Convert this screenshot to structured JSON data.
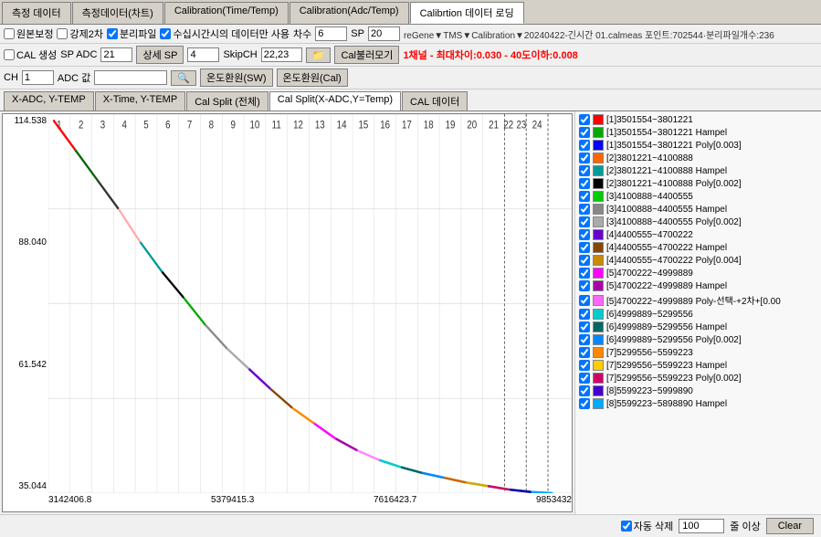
{
  "tabs": [
    {
      "label": "측정 데이터",
      "active": false
    },
    {
      "label": "측정데이터(차트)",
      "active": false
    },
    {
      "label": "Calibration(Time/Temp)",
      "active": false
    },
    {
      "label": "Calibration(Adc/Temp)",
      "active": false
    },
    {
      "label": "Calibrtion 데이터 로딩",
      "active": true
    }
  ],
  "toolbar1": {
    "checkbox_original": "원본보정",
    "checkbox_force2": "강제2차",
    "checkbox_split": "분리파일",
    "checkbox_time": "수십시간시의 데이터만 사용",
    "label_count": "차수",
    "input_count": "6",
    "label_sp": "SP",
    "input_sp": "20",
    "file_path": "reGene▼TMS▼Calibration▼20240422-긴시간\n01.calmeas 포인트:702544·분리파일개수:236"
  },
  "toolbar2": {
    "checkbox_cal": "CAL 생성",
    "label_spadc": "SP ADC",
    "input_spadc": "21",
    "label_sangsp": "상세 SP",
    "input_sangsp": "4",
    "label_skipch": "SkipCH",
    "input_skipch": "22,23",
    "btn_folder": "📁",
    "btn_cal": "Cal불러모기",
    "status": "1채널 - 최대차이:0.030 - 40도이하:0.008"
  },
  "toolbar3": {
    "label_ch": "CH",
    "input_ch": "1",
    "label_adc": "ADC 값",
    "input_adc": "",
    "btn_search": "🔍",
    "btn_temp_sw": "온도환원(SW)",
    "btn_temp_cal": "온도환원(Cal)"
  },
  "sub_tabs": [
    {
      "label": "X-ADC, Y-TEMP",
      "active": false
    },
    {
      "label": "X-Time, Y-TEMP",
      "active": false
    },
    {
      "label": "Cal Split (전체)",
      "active": false
    },
    {
      "label": "Cal Split(X-ADC,Y=Temp)",
      "active": true
    },
    {
      "label": "CAL 데이터",
      "active": false
    }
  ],
  "chart": {
    "y_max": "114.538",
    "y_mid1": "88.040",
    "y_mid2": "61.542",
    "y_min": "35.044",
    "x_labels": [
      "3142406.8",
      "5379415.3",
      "7616423.7",
      "9853432"
    ],
    "col_labels": [
      "1",
      "2",
      "3",
      "4",
      "5",
      "6",
      "7",
      "8",
      "9",
      "10",
      "11",
      "12",
      "13",
      "14",
      "15",
      "16",
      "17",
      "18",
      "19",
      "20",
      "21",
      "22",
      "23",
      "24"
    ]
  },
  "legend": [
    {
      "color": "#ff0000",
      "checked": true,
      "label": "[1]3501554~3801221"
    },
    {
      "color": "#00aa00",
      "checked": true,
      "label": "[1]3501554~3801221 Hampel"
    },
    {
      "color": "#0000ff",
      "checked": true,
      "label": "[1]3501554~3801221 Poly[0.003]"
    },
    {
      "color": "#ff6600",
      "checked": true,
      "label": "[2]3801221~4100888"
    },
    {
      "color": "#009999",
      "checked": true,
      "label": "[2]3801221~4100888 Hampel"
    },
    {
      "color": "#000000",
      "checked": true,
      "label": "[2]3801221~4100888 Poly[0.002]"
    },
    {
      "color": "#00cc00",
      "checked": true,
      "label": "[3]4100888~4400555"
    },
    {
      "color": "#888888",
      "checked": true,
      "label": "[3]4100888~4400555 Hampel"
    },
    {
      "color": "#aaaaaa",
      "checked": true,
      "label": "[3]4100888~4400555 Poly[0.002]"
    },
    {
      "color": "#6600cc",
      "checked": true,
      "label": "[4]4400555~4700222"
    },
    {
      "color": "#884400",
      "checked": true,
      "label": "[4]4400555~4700222 Hampel"
    },
    {
      "color": "#cc8800",
      "checked": true,
      "label": "[4]4400555~4700222 Poly[0.004]"
    },
    {
      "color": "#ff00ff",
      "checked": true,
      "label": "[5]4700222~4999889"
    },
    {
      "color": "#aa00aa",
      "checked": true,
      "label": "[5]4700222~4999889 Hampel"
    },
    {
      "color": "#ff66ff",
      "checked": true,
      "label": "[5]4700222~4999889 Poly-선택-+2차+[0.00"
    },
    {
      "color": "#00cccc",
      "checked": true,
      "label": "[6]4999889~5299556"
    },
    {
      "color": "#006666",
      "checked": true,
      "label": "[6]4999889~5299556 Hampel"
    },
    {
      "color": "#0088ff",
      "checked": true,
      "label": "[6]4999889~5299556 Poly[0.002]"
    },
    {
      "color": "#ff8800",
      "checked": true,
      "label": "[7]5299556~5599223"
    },
    {
      "color": "#ffcc00",
      "checked": true,
      "label": "[7]5299556~5599223 Hampel"
    },
    {
      "color": "#cc0066",
      "checked": true,
      "label": "[7]5299556~5599223 Poly[0.002]"
    },
    {
      "color": "#4400cc",
      "checked": true,
      "label": "[8]5599223~5999890"
    },
    {
      "color": "#00aaff",
      "checked": true,
      "label": "[8]5599223~5898890 Hampel"
    }
  ],
  "bottom_bar": {
    "checkbox_auto_delete": "자동 삭제",
    "input_threshold": "100",
    "label_threshold": "줄 이상",
    "btn_clear": "Clear"
  }
}
